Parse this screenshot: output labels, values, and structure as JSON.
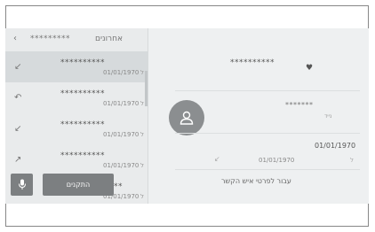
{
  "header": {
    "back_icon": "chevron-left-icon",
    "contact_stars": "*********",
    "separator": "•",
    "title": "אחרונים"
  },
  "call_list": [
    {
      "name": "**********",
      "date": "01/01/1970",
      "suffix": "ל",
      "direction_icon": "incoming-call-icon"
    },
    {
      "name": "**********",
      "date": "01/01/1970",
      "suffix": "ל",
      "direction_icon": "missed-call-icon"
    },
    {
      "name": "**********",
      "date": "01/01/1970",
      "suffix": "ל",
      "direction_icon": "incoming-call-icon"
    },
    {
      "name": "**********",
      "date": "01/01/1970",
      "suffix": "ל",
      "direction_icon": "outgoing-call-icon"
    },
    {
      "name": "****",
      "date": "01/01/1970",
      "suffix": "ל",
      "direction_icon": "incoming-call-icon"
    }
  ],
  "bottom": {
    "mic_icon": "microphone-icon",
    "fix_label": "התקנים"
  },
  "detail": {
    "name": "**********",
    "favorite_icon": "heart-icon",
    "avatar_icon": "person-icon",
    "number": "*******",
    "number_label": "נייד",
    "date": "01/01/1970",
    "call_date": "01/01/1970",
    "call_ref": "ל",
    "call_icon": "incoming-call-icon",
    "details_button": "עבור לפרטי איש הקשר"
  },
  "colors": {
    "screen_bg": "#e9ebec",
    "button_bg": "#7c7f81",
    "avatar_bg": "#8b8e90"
  }
}
